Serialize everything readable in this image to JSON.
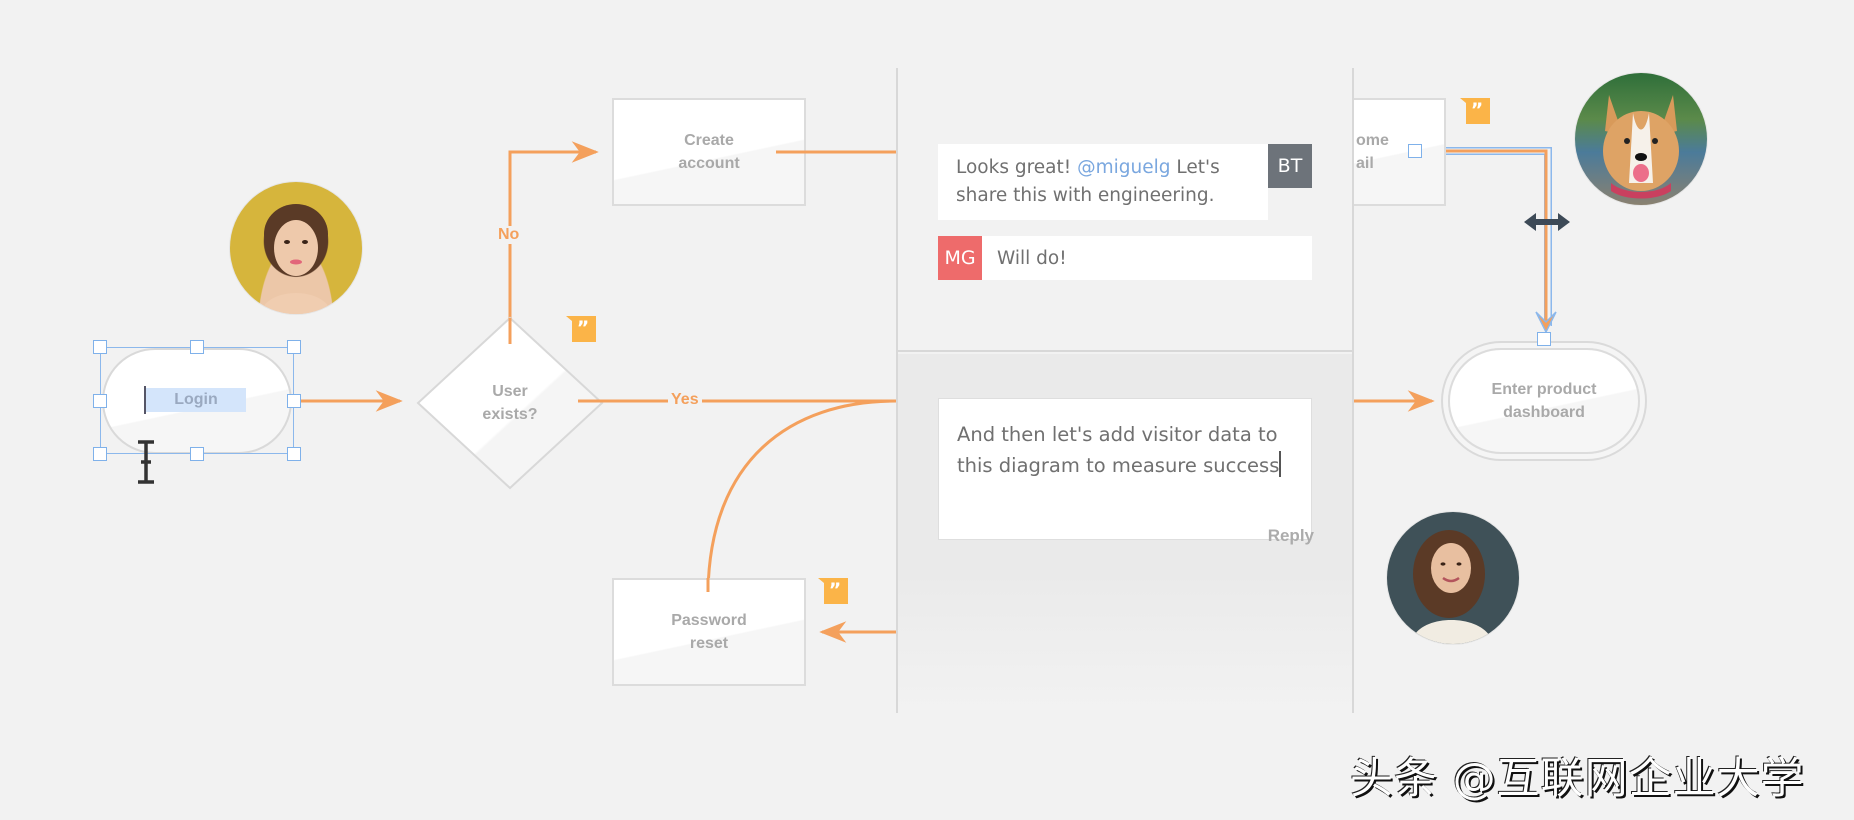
{
  "diagram": {
    "nodes": {
      "login": {
        "label": "Login",
        "shape": "terminator",
        "selected": true
      },
      "user_exists": {
        "label": "User\nexists?",
        "shape": "decision"
      },
      "create_account": {
        "label": "Create\naccount",
        "shape": "process"
      },
      "password_reset": {
        "label": "Password\nreset",
        "shape": "process"
      },
      "welcome_email": {
        "label": "ome\nail",
        "shape": "process",
        "note": "partially hidden behind comment panel"
      },
      "enter_dashboard": {
        "label": "Enter product\ndashboard",
        "shape": "terminator"
      }
    },
    "edge_labels": {
      "no": "No",
      "yes": "Yes"
    }
  },
  "comments": {
    "thread": [
      {
        "initials": "BT",
        "initials_color": "#6d737a",
        "text_before": "Looks great! ",
        "mention": "@miguelg",
        "text_after": " Let's share this with engineering."
      },
      {
        "initials": "MG",
        "initials_color": "#ee6b6b",
        "text": "Will do!"
      }
    ],
    "reply_input_value": "And then let's add visitor data to this diagram to measure success",
    "reply_button_label": "Reply"
  },
  "collaborators": [
    {
      "name": "woman-yellow-background",
      "icon": "avatar-photo"
    },
    {
      "name": "corgi-dog",
      "icon": "avatar-photo"
    },
    {
      "name": "woman-curly-hair",
      "icon": "avatar-photo"
    }
  ],
  "colors": {
    "connector": "#f4a05c",
    "selection": "#7fb1ea",
    "comment_badge": "#fbb448",
    "background": "#f2f2f2"
  },
  "watermark": "头条 @互联网企业大学"
}
